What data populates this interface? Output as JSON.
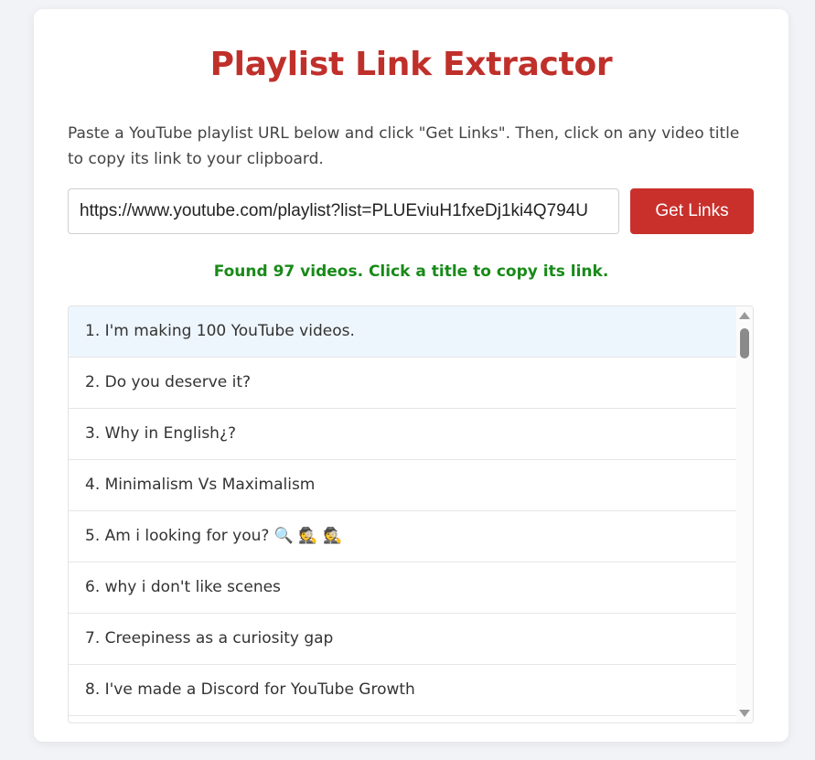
{
  "header": {
    "title": "Playlist Link Extractor"
  },
  "intro": {
    "text": "Paste a YouTube playlist URL below and click \"Get Links\". Then, click on any video title to copy its link to your clipboard."
  },
  "form": {
    "url_value": "https://www.youtube.com/playlist?list=PLUEviuH1fxeDj1ki4Q794U",
    "button_label": "Get Links"
  },
  "status": {
    "text": "Found 97 videos. Click a title to copy its link."
  },
  "videos": [
    "1. I'm making 100 YouTube videos.",
    "2. Do you deserve it?",
    "3. Why in English¿?",
    "4. Minimalism Vs Maximalism",
    "5. Am i looking for you? 🔍 🕵️ 🕵️",
    "6. why i don't like scenes",
    "7. Creepiness as a curiosity gap",
    "8. I've made a Discord for YouTube Growth"
  ],
  "colors": {
    "title": "#c0302b",
    "button": "#c9302c",
    "status": "#188a18",
    "active_row": "#eef6fd"
  }
}
